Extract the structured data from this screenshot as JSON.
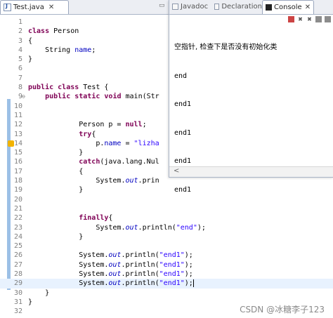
{
  "editor": {
    "tab_title": "Test.java",
    "tab_close": "✕",
    "lines": [
      {
        "n": "1",
        "html": ""
      },
      {
        "n": "2",
        "html": "<span class='kw'>class</span> Person"
      },
      {
        "n": "3",
        "html": "{"
      },
      {
        "n": "4",
        "html": "    String <span class='fld'>name</span>;"
      },
      {
        "n": "5",
        "html": "}"
      },
      {
        "n": "6",
        "html": ""
      },
      {
        "n": "7",
        "html": ""
      },
      {
        "n": "8",
        "html": "<span class='kw'>public</span> <span class='kw'>class</span> Test {"
      },
      {
        "n": "9",
        "html": "    <span class='kw'>public</span> <span class='kw'>static</span> <span class='kw'>void</span> main(Str"
      },
      {
        "n": "10",
        "html": ""
      },
      {
        "n": "11",
        "html": ""
      },
      {
        "n": "12",
        "html": "            Person p = <span class='kw'>null</span>;"
      },
      {
        "n": "13",
        "html": "            <span class='kw'>try</span>{"
      },
      {
        "n": "14",
        "html": "                p.<span class='fld'>name</span> = <span class='str'>\"lizha</span>"
      },
      {
        "n": "15",
        "html": "            }"
      },
      {
        "n": "16",
        "html": "            <span class='kw'>catch</span>(java.lang.Nul"
      },
      {
        "n": "17",
        "html": "            {"
      },
      {
        "n": "18",
        "html": "                System.<span class='ital'>out</span>.prin"
      },
      {
        "n": "19",
        "html": "            }"
      },
      {
        "n": "20",
        "html": ""
      },
      {
        "n": "21",
        "html": ""
      },
      {
        "n": "22",
        "html": "            <span class='kw'>finally</span>{"
      },
      {
        "n": "23",
        "html": "                System.<span class='ital'>out</span>.println(<span class='str'>\"end\"</span>);"
      },
      {
        "n": "24",
        "html": "            }"
      },
      {
        "n": "25",
        "html": ""
      },
      {
        "n": "26",
        "html": "            System.<span class='ital'>out</span>.println(<span class='str'>\"end1\"</span>);"
      },
      {
        "n": "27",
        "html": "            System.<span class='ital'>out</span>.println(<span class='str'>\"end1\"</span>);"
      },
      {
        "n": "28",
        "html": "            System.<span class='ital'>out</span>.println(<span class='str'>\"end1\"</span>);"
      },
      {
        "n": "29",
        "html": "            System.<span class='ital'>out</span>.println(<span class='str'>\"end1\"</span>);<span class='caret'></span>"
      },
      {
        "n": "30",
        "html": "    }"
      },
      {
        "n": "31",
        "html": "}"
      },
      {
        "n": "32",
        "html": ""
      }
    ]
  },
  "console": {
    "tabs": [
      {
        "label": "Javadoc",
        "active": false
      },
      {
        "label": "Declaration",
        "active": false
      },
      {
        "label": "Console",
        "active": true
      }
    ],
    "tab_close": "✕",
    "output": [
      "空指针, 检查下是否没有初始化类",
      "end",
      "end1",
      "end1",
      "end1",
      "end1"
    ],
    "scroll_arrow": "<"
  },
  "watermark": "CSDN @冰糖李子123"
}
